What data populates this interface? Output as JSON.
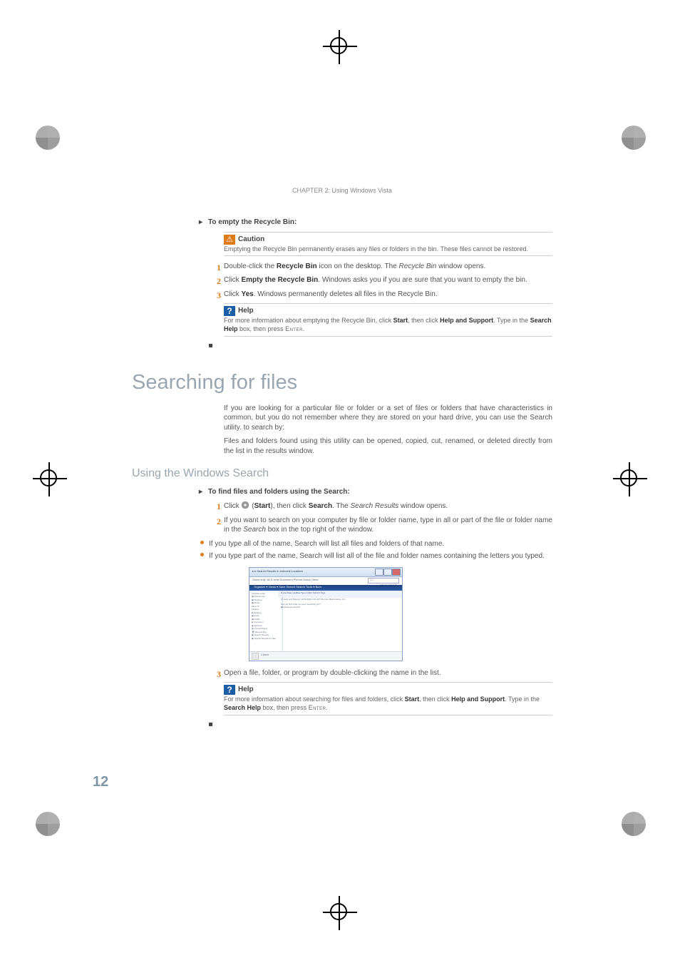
{
  "runhead": "CHAPTER 2: Using Windows Vista",
  "proc1": {
    "title": "To empty the Recycle Bin:",
    "caution": {
      "title": "Caution",
      "body": "Emptying the Recycle Bin permanently erases any files or folders in the bin. These files cannot be restored."
    },
    "steps": [
      {
        "n": "1",
        "pre": "Double-click the ",
        "b1": "Recycle Bin",
        "mid": " icon on the desktop. The ",
        "i1": "Recycle Bin",
        "post": " window opens."
      },
      {
        "n": "2",
        "pre": "Click ",
        "b1": "Empty the Recycle Bin",
        "post": ". Windows asks you if you are sure that you want to empty the bin."
      },
      {
        "n": "3",
        "pre": "Click ",
        "b1": "Yes",
        "post": ". Windows permanently deletes all files in the Recycle Bin."
      }
    ],
    "help": {
      "title": "Help",
      "l1a": "For more information about emptying the Recycle Bin, click ",
      "l1b": "Start",
      "l1c": ", then click ",
      "l1d": "Help and Support",
      "l1e": ". Type",
      "l2a": " in the ",
      "l2b": "Search Help",
      "l2c": " box, then press ",
      "l2d": "Enter",
      "l2e": "."
    }
  },
  "h1": "Searching for files",
  "intro1": "If you are looking for a particular file or folder or a set of files or folders that have characteristics in common, but you do not remember where they are stored on your hard drive, you can use the Search utility. to search by:",
  "intro2": "Files and folders found using this utility can be opened, copied, cut, renamed, or deleted directly from the list in the results window.",
  "h2": "Using the Windows Search",
  "proc2": {
    "title": "To find files and folders using the Search:",
    "steps": [
      {
        "n": "1",
        "pre": "Click ",
        "logo": true,
        "mid": " (",
        "b1": "Start",
        "mid2": "), then click ",
        "b2": "Search",
        "mid3": ". The ",
        "i1": "Search Results",
        "post": " window opens."
      },
      {
        "n": "2",
        "pre": "If you want to search on your computer by file or folder name, type in all or part of the file or folder name in the ",
        "i1": "Search",
        "post": " box in the top right of the window."
      }
    ],
    "bullets": [
      "If you type all of the name, Search will list all files and folders of that name.",
      "If you type part of the name, Search will list all of the file and folder names containing the letters you typed."
    ],
    "step3": {
      "n": "3",
      "text": "Open a file, folder, or program by double-clicking the name in the list."
    },
    "help": {
      "title": "Help",
      "l1a": "For more information about searching for files and folders, click ",
      "l1b": "Start",
      "l1c": ", then click ",
      "l1d": "Help and Support",
      "l1e": ". Type",
      "l2a": " in the ",
      "l2b": "Search Help",
      "l2c": " box, then press ",
      "l2d": "Enter",
      "l2e": "."
    }
  },
  "figure": {
    "breadcrumb": " ▸  ▸ Search Results in Indexed Locations",
    "searchPlaceholder": "help",
    "tabs": "Show only:  All   E-mail   Document   Picture   Music   Other",
    "advanced": "Advanced Search ⌄",
    "toolbar": "Organize ▾   Views ▾   Save Search   Search Tools ▾   Burn",
    "cols": "Name          Date modified      Type        Folder        Authors    Tags",
    "sidebar": [
      "Favorite Links",
      "▦ Documents",
      "▦ Pictures",
      "▦ Music",
      "More ≫",
      "",
      "Folders",
      "■ Desktop",
      "▦ emily",
      "▦ Public",
      "■ Computer",
      "◉ Network",
      "◉ Control Panel",
      "🗑 Recycle Bin",
      "▣ Search Results",
      "▣ Search Results in Inde"
    ],
    "results": [
      {
        "n": "🛈 Help and Support",
        "d": "12/31/2006 3:31 AM",
        "t": "Shortcut",
        "f": "Maintenance (C:\\..."
      }
    ],
    "hint": "Did you find what you were searching for?",
    "hint2": "▣ Advanced Search",
    "status": "1 item"
  },
  "pageNumber": "12"
}
